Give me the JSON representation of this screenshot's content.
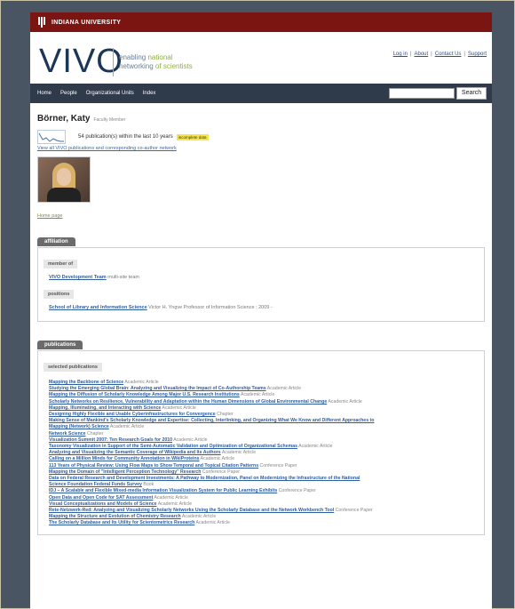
{
  "university": "INDIANA UNIVERSITY",
  "brand": {
    "logo": "VIVO",
    "tagline_line1_a": "enabling",
    "tagline_line1_b": "national",
    "tagline_line2_a": "networking",
    "tagline_line2_b": "of scientists"
  },
  "toplinks": [
    "Log in",
    "About",
    "Contact Us",
    "Support"
  ],
  "nav": {
    "items": [
      "Home",
      "People",
      "Organizational Units",
      "Index"
    ],
    "search_button": "Search"
  },
  "profile": {
    "name": "Börner, Katy",
    "role": "Faculty Member",
    "pub_count": "54",
    "pub_text": "publication(s) within the last 10 years",
    "badge": "incomplete data",
    "coauthor_link": "View all VIVO publications and corresponding co-author network",
    "homepage": "Home page"
  },
  "affiliation": {
    "tab": "affiliation",
    "member_label": "member of",
    "member_link": "VIVO Development Team",
    "member_note": "multi-site team",
    "positions_label": "positions",
    "position_link": "School of Library and Information Science",
    "position_note": "Victor H. Yngve Professor of Information Science : 2009 -"
  },
  "publications": {
    "tab": "publications",
    "sub_label": "selected publications",
    "items": [
      {
        "title": "Mapping the Backbone of Science",
        "type": "Academic Article"
      },
      {
        "title": "Studying the Emerging Global Brain: Analyzing and Visualizing the Impact of Co-Authorship Teams",
        "type": "Academic Article"
      },
      {
        "title": "Mapping the Diffusion of Scholarly Knowledge Among Major U.S. Research Institutions",
        "type": "Academic Article"
      },
      {
        "title": "Scholarly Networks on Resilience, Vulnerability and Adaptation within the Human Dimensions of Global Environmental Change",
        "type": "Academic Article"
      },
      {
        "title": "Mapping, Illuminating, and Interacting with Science",
        "type": "Academic Article"
      },
      {
        "title": "Designing Highly Flexible and Usable Cyberinfrastructures for Convergence",
        "type": "Chapter"
      },
      {
        "title": "Making Sense of Mankind's Scholarly Knowledge and Expertise: Collecting, Interlinking, and Organizing What We Know and Different Approaches to",
        "type": ""
      },
      {
        "title": "Mapping (Network) Science",
        "type": "Academic Article"
      },
      {
        "title": "Network Science",
        "type": "Chapter"
      },
      {
        "title": "Visualization Summit 2007: Ten Research Goals for 2010",
        "type": "Academic Article"
      },
      {
        "title": "Taxonomy Visualization in Support of the Semi-Automatic Validation and Optimization of Organizational Schemas",
        "type": "Academic Article"
      },
      {
        "title": "Analyzing and Visualizing the Semantic Coverage of Wikipedia and Its Authors",
        "type": "Academic Article"
      },
      {
        "title": "Calling on a Million Minds for Community Annotation in WikiProteins",
        "type": "Academic Article"
      },
      {
        "title": "113 Years of Physical Review: Using Flow Maps to Show Temporal and Topical Citation Patterns",
        "type": "Conference Paper"
      },
      {
        "title": "Mapping the Domain of \"Intelligent Perception Technology\" Research",
        "type": "Conference Paper"
      },
      {
        "title": "Data on Federal Research and Development Investments: A Pathway to Modernization, Panel on Modernizing the Infrastructure of the National",
        "type": ""
      },
      {
        "title": "Science Foundation Federal Funds Survey",
        "type": "Book"
      },
      {
        "title": "IDJ – A Scalable and Flexible Mixed-media Information Visualization System for Public Learning Exhibits",
        "type": "Conference Paper"
      },
      {
        "title": "Open Data and Open Code for SAT Assessment",
        "type": "Academic Article"
      },
      {
        "title": "Visual Conceptualizations and Models of Science",
        "type": "Academic Article"
      },
      {
        "title": "Rete-Netzwerk-Red: Analyzing and Visualizing Scholarly Networks Using the Scholarly Database and the Network Workbench Tool",
        "type": "Conference Paper"
      },
      {
        "title": "Mapping the Structure and Evolution of Chemistry Research",
        "type": "Academic Article"
      },
      {
        "title": "The Scholarly Database and Its Utility for Scientometrics Research",
        "type": "Academic Article"
      }
    ]
  }
}
